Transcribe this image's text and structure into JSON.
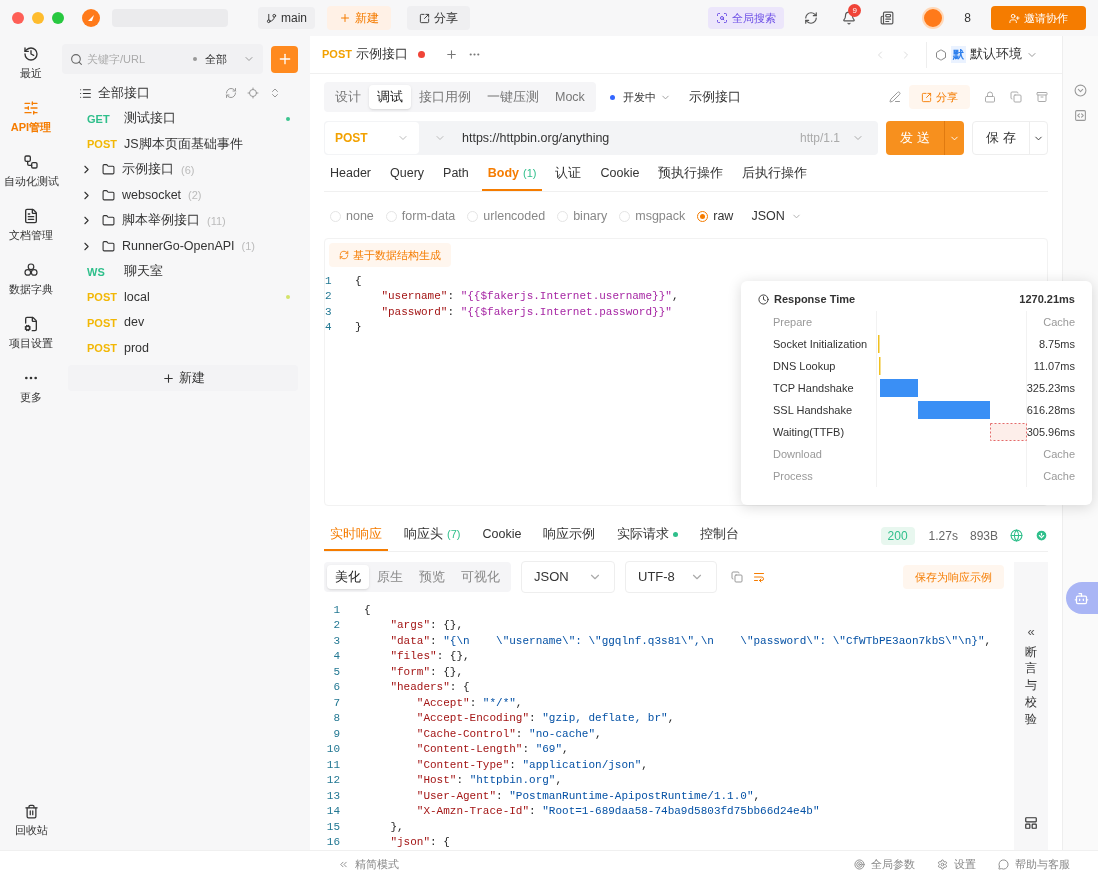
{
  "topbar": {
    "branch": "main",
    "new_label": "新建",
    "share_label": "分享",
    "search_label": "全局搜索",
    "notification_count": "9",
    "member_count": "8",
    "invite_label": "邀请协作"
  },
  "nav": {
    "items": [
      {
        "kind": "recent",
        "label": "最近",
        "selected": false
      },
      {
        "kind": "api",
        "label": "API管理",
        "selected": true
      },
      {
        "kind": "auto",
        "label": "自动化测试",
        "selected": false
      },
      {
        "kind": "docs",
        "label": "文档管理",
        "selected": false
      },
      {
        "kind": "dict",
        "label": "数据字典",
        "selected": false
      },
      {
        "kind": "project",
        "label": "项目设置",
        "selected": false
      },
      {
        "kind": "more",
        "label": "更多",
        "selected": false
      }
    ],
    "trash_label": "回收站"
  },
  "sidebar": {
    "search_placeholder": "关键字/URL",
    "filter": "全部",
    "root_label": "全部接口",
    "items": [
      {
        "kind": "api",
        "method": "GET",
        "color": "#2fbf8b",
        "name": "测试接口",
        "dot": {
          "color": "#3cc48f"
        }
      },
      {
        "kind": "api",
        "method": "POST",
        "color": "#f2b705",
        "name": "JS脚本页面基础事件"
      },
      {
        "kind": "folder",
        "name": "示例接口",
        "count": "(6)",
        "expanded": false
      },
      {
        "kind": "folder",
        "name": "websocket",
        "count": "(2)",
        "expanded": false
      },
      {
        "kind": "folder",
        "name": "脚本举例接口",
        "count": "(11)",
        "expanded": false
      },
      {
        "kind": "folder",
        "name": "RunnerGo-OpenAPI",
        "count": "(1)",
        "expanded": false
      },
      {
        "kind": "api",
        "method": "WS",
        "color": "#2fbf8b",
        "name": "聊天室"
      },
      {
        "kind": "api",
        "method": "POST",
        "color": "#f2b705",
        "name": "local",
        "dot": {
          "color": "#d4e36a"
        }
      },
      {
        "kind": "api",
        "method": "POST",
        "color": "#f2b705",
        "name": "dev"
      },
      {
        "kind": "api",
        "method": "POST",
        "color": "#f2b705",
        "name": "prod"
      }
    ],
    "new_label": "新建"
  },
  "editor_tab": {
    "method": "POST",
    "title": "示例接口",
    "unsaved": true
  },
  "environment": {
    "badge": "默",
    "name": "默认环境"
  },
  "mode_tabs": [
    {
      "label": "设计",
      "selected": false
    },
    {
      "label": "调试",
      "selected": true
    },
    {
      "label": "接口用例",
      "selected": false
    },
    {
      "label": "一键压测",
      "selected": false
    },
    {
      "label": "Mock",
      "selected": false
    }
  ],
  "status": {
    "label": "开发中",
    "color": "#3366ff"
  },
  "api_name": "示例接口",
  "share_label": "分享",
  "request": {
    "method": "POST",
    "url": "https://httpbin.org/anything",
    "protocol": "http/1.1",
    "send_label": "发 送",
    "save_label": "保 存"
  },
  "param_tabs": [
    {
      "label": "Header",
      "selected": false
    },
    {
      "label": "Query",
      "selected": false
    },
    {
      "label": "Path",
      "selected": false
    },
    {
      "label": "Body",
      "count": "(1)",
      "selected": true
    },
    {
      "label": "认证",
      "selected": false
    },
    {
      "label": "Cookie",
      "selected": false
    },
    {
      "label": "预执行操作",
      "selected": false
    },
    {
      "label": "后执行操作",
      "selected": false
    }
  ],
  "body_types": [
    {
      "label": "none",
      "selected": false
    },
    {
      "label": "form-data",
      "selected": false
    },
    {
      "label": "urlencoded",
      "selected": false
    },
    {
      "label": "binary",
      "selected": false
    },
    {
      "label": "msgpack",
      "selected": false
    },
    {
      "label": "raw",
      "selected": true
    }
  ],
  "body_format": "JSON",
  "generate_label": "基于数据结构生成",
  "request_body": [
    {
      "number": "1",
      "text": "{"
    },
    {
      "number": "2",
      "text": "    \"username\": \"{{$fakerjs.Internet.username}}\","
    },
    {
      "number": "3",
      "text": "    \"password\": \"{{$fakerjs.Internet.password}}\""
    },
    {
      "number": "4",
      "text": "}"
    }
  ],
  "timing": {
    "title": "Response Time",
    "total": "1270.21ms",
    "rows": [
      {
        "kind": "cache",
        "label": "Prepare",
        "value": "Cache"
      },
      {
        "kind": "tick",
        "label": "Socket Initialization",
        "value": "8.75ms"
      },
      {
        "kind": "tick",
        "label": "DNS Lookup",
        "value": "11.07ms"
      },
      {
        "kind": "bar",
        "label": "TCP Handshake",
        "value": "325.23ms"
      },
      {
        "kind": "bar",
        "label": "SSL Handshake",
        "value": "616.28ms"
      },
      {
        "kind": "wait",
        "label": "Waiting(TTFB)",
        "value": "305.96ms"
      },
      {
        "kind": "cache",
        "label": "Download",
        "value": "Cache"
      },
      {
        "kind": "cache",
        "label": "Process",
        "value": "Cache"
      }
    ]
  },
  "response_tabs": [
    {
      "label": "实时响应",
      "selected": true
    },
    {
      "label": "响应头",
      "count": "(7)",
      "selected": false
    },
    {
      "label": "Cookie",
      "selected": false
    },
    {
      "label": "响应示例",
      "selected": false
    },
    {
      "label": "实际请求",
      "dot": true,
      "selected": false
    },
    {
      "label": "控制台",
      "selected": false
    }
  ],
  "response_meta": {
    "status": "200",
    "time": "1.27s",
    "size": "893B"
  },
  "view_tabs": [
    {
      "label": "美化",
      "selected": true
    },
    {
      "label": "原生",
      "selected": false
    },
    {
      "label": "预览",
      "selected": false
    },
    {
      "label": "可视化",
      "selected": false
    }
  ],
  "response_format": "JSON",
  "response_encoding": "UTF-8",
  "save_example_label": "保存为响应示例",
  "response_body": [
    {
      "number": "1",
      "text": "{"
    },
    {
      "number": "2",
      "text": "    \"args\": {},"
    },
    {
      "number": "3",
      "text": "    \"data\": \"{\\n    \\\"username\\\": \\\"ggqlnf.q3s81\\\",\\n    \\\"password\\\": \\\"CfWTbPE3aon7kbS\\\"\\n}\","
    },
    {
      "number": "4",
      "text": "    \"files\": {},"
    },
    {
      "number": "5",
      "text": "    \"form\": {},"
    },
    {
      "number": "6",
      "text": "    \"headers\": {"
    },
    {
      "number": "7",
      "text": "        \"Accept\": \"*/*\","
    },
    {
      "number": "8",
      "text": "        \"Accept-Encoding\": \"gzip, deflate, br\","
    },
    {
      "number": "9",
      "text": "        \"Cache-Control\": \"no-cache\","
    },
    {
      "number": "10",
      "text": "        \"Content-Length\": \"69\","
    },
    {
      "number": "11",
      "text": "        \"Content-Type\": \"application/json\","
    },
    {
      "number": "12",
      "text": "        \"Host\": \"httpbin.org\","
    },
    {
      "number": "13",
      "text": "        \"User-Agent\": \"PostmanRuntime-ApipostRuntime/1.1.0\","
    },
    {
      "number": "14",
      "text": "        \"X-Amzn-Trace-Id\": \"Root=1-689daa58-74ba9d5803fd75bb66d24e4b\""
    },
    {
      "number": "15",
      "text": "    },"
    },
    {
      "number": "16",
      "text": "    \"json\": {"
    }
  ],
  "side_panel": {
    "toggle": "«",
    "label": "断言与校验"
  },
  "statusbar": {
    "compact_label": "精简模式",
    "items": [
      {
        "kind": "params",
        "label": "全局参数"
      },
      {
        "kind": "settings",
        "label": "设置"
      },
      {
        "kind": "help",
        "label": "帮助与客服"
      }
    ]
  }
}
